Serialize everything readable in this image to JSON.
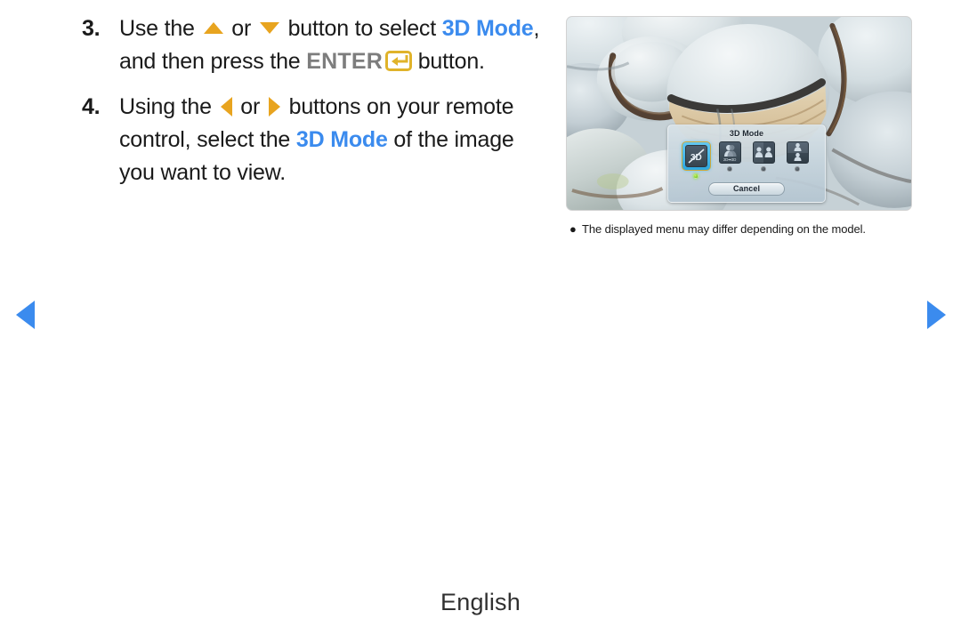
{
  "document": {
    "footer_language": "English"
  },
  "steps": [
    {
      "number": "3.",
      "segments": [
        {
          "type": "text",
          "value": "Use the "
        },
        {
          "type": "icon",
          "value": "triangle-up-icon"
        },
        {
          "type": "text",
          "value": " or "
        },
        {
          "type": "icon",
          "value": "triangle-down-icon"
        },
        {
          "type": "text",
          "value": " button to select "
        },
        {
          "type": "blue",
          "value": "3D Mode"
        },
        {
          "type": "text",
          "value": ", and then press the "
        },
        {
          "type": "gray",
          "value": "ENTER"
        },
        {
          "type": "icon",
          "value": "enter-key-icon"
        },
        {
          "type": "text",
          "value": " button."
        }
      ],
      "plain_text": "Use the ▲ or ▼ button to select 3D Mode, and then press the ENTER button."
    },
    {
      "number": "4.",
      "segments": [
        {
          "type": "text",
          "value": "Using the "
        },
        {
          "type": "icon",
          "value": "triangle-left-icon"
        },
        {
          "type": "text",
          "value": " or "
        },
        {
          "type": "icon",
          "value": "triangle-right-icon"
        },
        {
          "type": "text",
          "value": " buttons on your remote control, select the "
        },
        {
          "type": "blue",
          "value": "3D Mode"
        },
        {
          "type": "text",
          "value": " of the image you want to view."
        }
      ],
      "plain_text": "Using the ◀ or ▶ buttons on your remote control, select the 3D Mode of the image you want to view."
    }
  ],
  "step3_parts": {
    "lead": "Use the ",
    "or": " or ",
    "mid": " button to select ",
    "kw": "3D Mode",
    "after_kw": ", and then press the ",
    "enter_label": "ENTER",
    "tail": " button."
  },
  "step4_parts": {
    "lead": "Using the ",
    "or": " or ",
    "mid": " buttons on your remote control, select the ",
    "kw": "3D Mode",
    "tail": " of the image you want to view."
  },
  "tv_screen": {
    "alt": "Close-up photograph of pale blue-gray pebbles with dark banded stripes",
    "osd": {
      "title": "3D Mode",
      "cancel_label": "Cancel",
      "modes": [
        {
          "id": "off",
          "tile_label": "",
          "selected": true,
          "led": "green",
          "icon": "3d-off-icon"
        },
        {
          "id": "2d-to-3d",
          "tile_label": "2D➡3D",
          "selected": false,
          "led": "gray",
          "icon": "2d-to-3d-icon"
        },
        {
          "id": "side-by-side",
          "tile_label": "",
          "selected": false,
          "led": "gray",
          "icon": "side-by-side-icon"
        },
        {
          "id": "top-bottom",
          "tile_label": "",
          "selected": false,
          "led": "gray",
          "icon": "top-bottom-icon"
        }
      ]
    }
  },
  "caption": {
    "bullet": "●",
    "text": "The displayed menu may differ depending on the model."
  },
  "navigation": {
    "prev_label": "Previous page",
    "next_label": "Next page"
  },
  "colors": {
    "accent_blue": "#3b8bee",
    "key_amber": "#e8a41f",
    "enter_border": "#e0b32a",
    "gray_label": "#7d7d7d",
    "text": "#1a1a1a"
  }
}
